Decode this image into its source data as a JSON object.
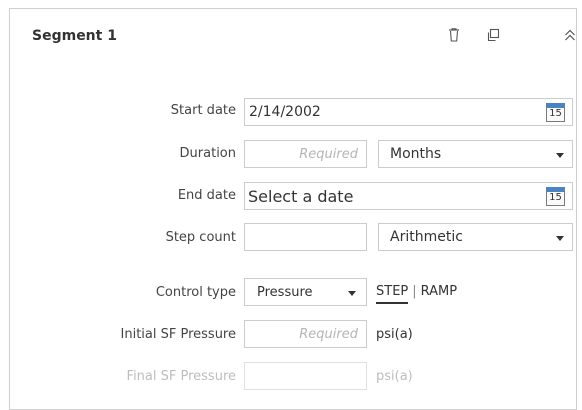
{
  "segment": {
    "title": "Segment 1",
    "icons": {
      "delete": "trash-icon",
      "duplicate": "copy-icon",
      "collapse": "chevron-up-double-icon"
    }
  },
  "form": {
    "start_date": {
      "label": "Start date",
      "value": "2/14/2002",
      "calendar_day": "15"
    },
    "duration": {
      "label": "Duration",
      "placeholder": "Required",
      "unit": "Months"
    },
    "end_date": {
      "label": "End date",
      "placeholder": "Select a date",
      "calendar_day": "15"
    },
    "step_count": {
      "label": "Step count",
      "value": "",
      "type": "Arithmetic"
    },
    "control_type": {
      "label": "Control type",
      "value": "Pressure",
      "option_step": "STEP",
      "separator": "|",
      "option_ramp": "RAMP"
    },
    "initial_sf_pressure": {
      "label": "Initial SF Pressure",
      "placeholder": "Required",
      "unit": "psi(a)"
    },
    "final_sf_pressure": {
      "label": "Final SF Pressure",
      "unit": "psi(a)"
    }
  },
  "colors": {
    "accent": "#4a82c4",
    "border": "#cccccc",
    "disabled_text": "#bdbdbd"
  }
}
